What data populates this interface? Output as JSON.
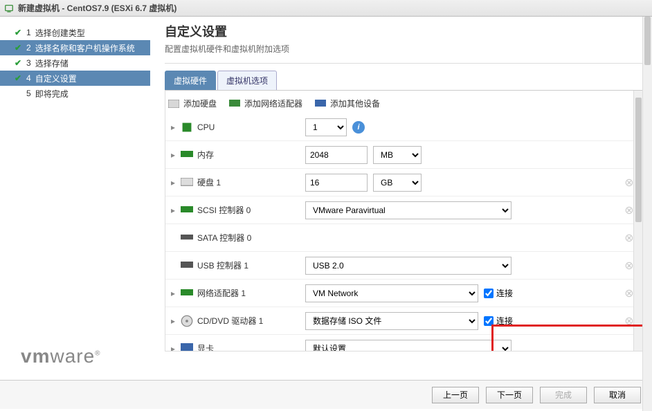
{
  "title": "新建虚拟机 - CentOS7.9 (ESXi 6.7 虚拟机)",
  "sidebar": {
    "steps": [
      {
        "num": "1",
        "label": "选择创建类型",
        "checked": true
      },
      {
        "num": "2",
        "label": "选择名称和客户机操作系统",
        "checked": true
      },
      {
        "num": "3",
        "label": "选择存储",
        "checked": true
      },
      {
        "num": "4",
        "label": "自定义设置",
        "checked": true,
        "active": true
      },
      {
        "num": "5",
        "label": "即将完成",
        "checked": false
      }
    ],
    "logo_a": "vm",
    "logo_b": "ware",
    "logo_r": "®"
  },
  "main": {
    "heading": "自定义设置",
    "subtitle": "配置虚拟机硬件和虚拟机附加选项",
    "tabs": [
      {
        "label": "虚拟硬件",
        "active": true
      },
      {
        "label": "虚拟机选项"
      }
    ],
    "toolbar": {
      "addDisk": "添加硬盘",
      "addNic": "添加网络适配器",
      "addOther": "添加其他设备"
    },
    "rows": {
      "cpu": {
        "label": "CPU",
        "value": "1"
      },
      "mem": {
        "label": "内存",
        "value": "2048",
        "unit": "MB"
      },
      "disk": {
        "label": "硬盘 1",
        "value": "16",
        "unit": "GB"
      },
      "scsi": {
        "label": "SCSI 控制器 0",
        "value": "VMware Paravirtual"
      },
      "sata": {
        "label": "SATA 控制器 0"
      },
      "usb": {
        "label": "USB 控制器 1",
        "value": "USB 2.0"
      },
      "nic": {
        "label": "网络适配器 1",
        "value": "VM Network",
        "connect": "连接"
      },
      "cd": {
        "label": "CD/DVD 驱动器 1",
        "value": "数据存储 ISO 文件",
        "connect": "连接"
      },
      "gpu": {
        "label": "显卡",
        "value": "默认设置"
      }
    }
  },
  "footer": {
    "prev": "上一页",
    "next": "下一页",
    "finish": "完成",
    "cancel": "取消"
  }
}
